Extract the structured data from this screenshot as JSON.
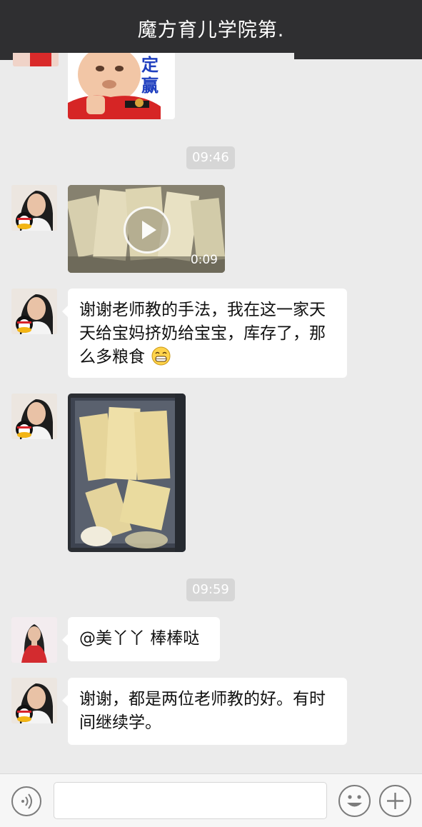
{
  "header": {
    "title": "魔方育儿学院第."
  },
  "messages": {
    "time_1": "09:46",
    "time_2": "09:59",
    "video": {
      "duration": "0:09"
    },
    "text_1": "谢谢老师教的手法，我在这一家天天给宝妈挤奶给宝宝，库存了，那么多粮食",
    "text_1_emoji": "grinning-face-emoji",
    "text_2": "@美丫丫 棒棒哒",
    "text_3": "谢谢，都是两位老师教的好。有时间继续学。",
    "sticker_chars": [
      "定",
      "赢"
    ]
  },
  "input_bar": {
    "voice_icon": "voice-icon",
    "emoji_icon": "emoji-icon",
    "add_icon": "add-icon"
  },
  "colors": {
    "header_bg": "#2f2f31",
    "chat_bg": "#ebebeb",
    "bubble_bg": "#ffffff",
    "time_chip_bg": "#d6d6d6"
  }
}
